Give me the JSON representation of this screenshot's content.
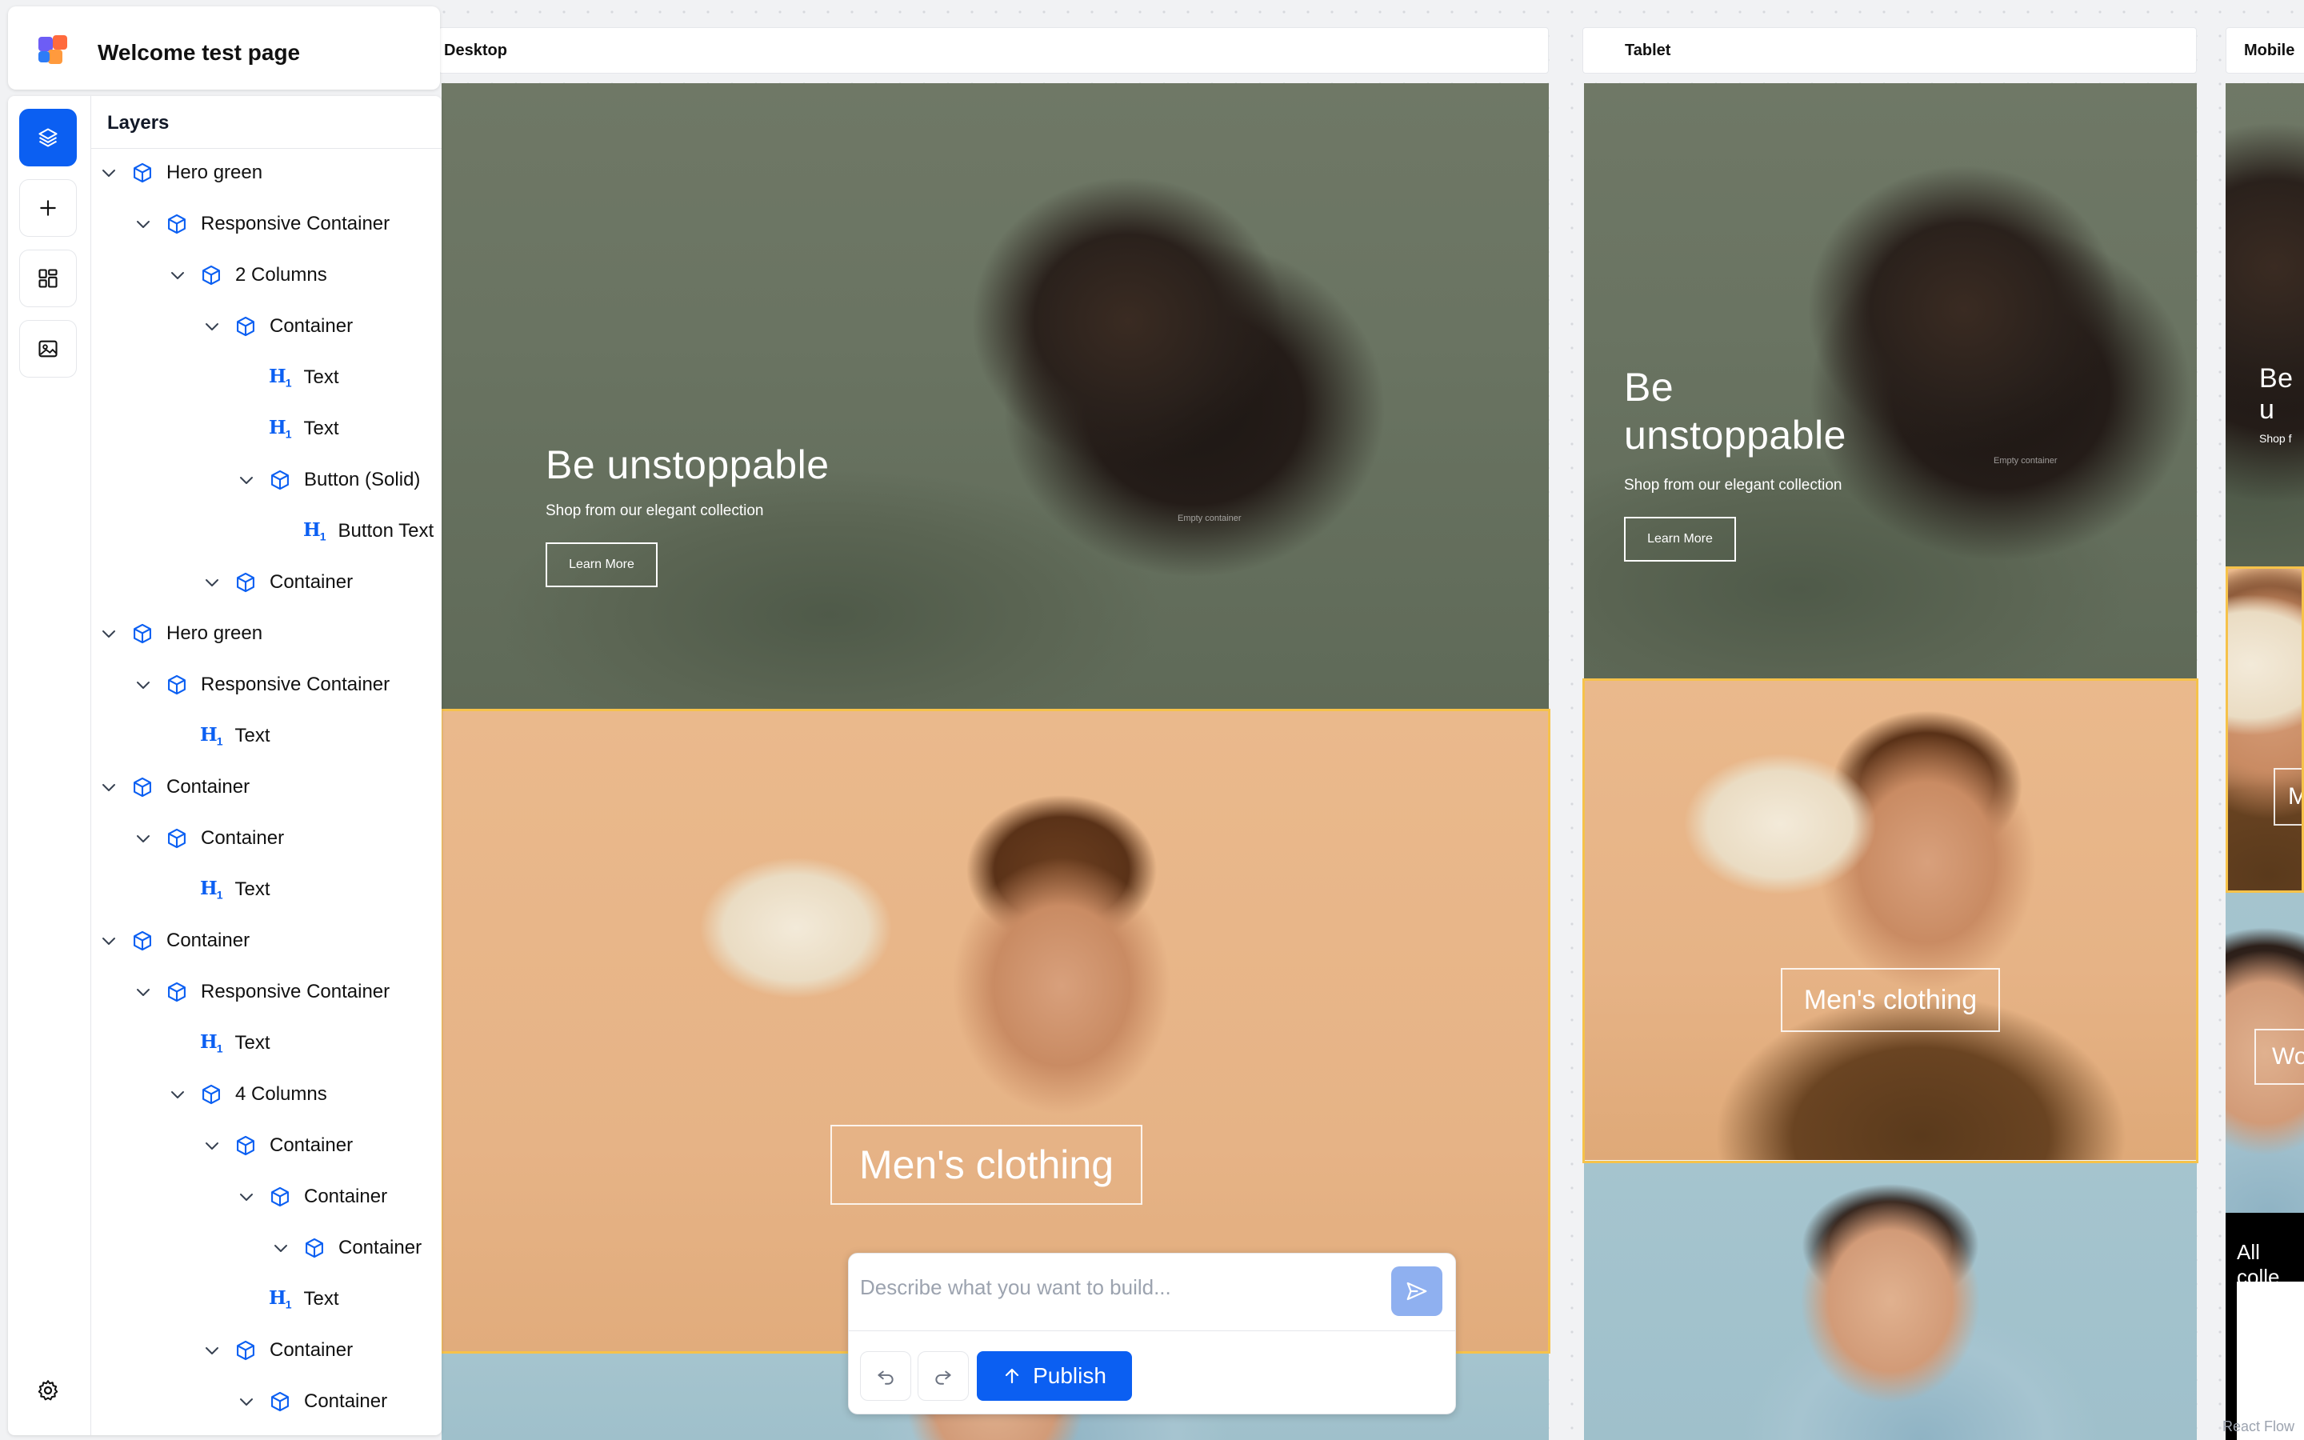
{
  "app": {
    "page_title": "Welcome test page"
  },
  "panel": {
    "layers_title": "Layers",
    "rail": [
      "layers-icon",
      "plus-icon",
      "blocks-icon",
      "image-icon",
      "gear-icon"
    ],
    "layers": [
      {
        "label": "Hero green",
        "type": "box",
        "depth": 0,
        "expanded": true
      },
      {
        "label": "Responsive Container",
        "type": "box",
        "depth": 1,
        "expanded": true
      },
      {
        "label": "2 Columns",
        "type": "box",
        "depth": 2,
        "expanded": true
      },
      {
        "label": "Container",
        "type": "box",
        "depth": 3,
        "expanded": true
      },
      {
        "label": "Text",
        "type": "heading",
        "depth": 4
      },
      {
        "label": "Text",
        "type": "heading",
        "depth": 4
      },
      {
        "label": "Button (Solid)",
        "type": "box",
        "depth": 4,
        "expanded": true
      },
      {
        "label": "Button Text",
        "type": "heading",
        "depth": 5
      },
      {
        "label": "Container",
        "type": "box",
        "depth": 3,
        "expanded": true
      },
      {
        "label": "Hero green",
        "type": "box",
        "depth": 0,
        "expanded": true
      },
      {
        "label": "Responsive Container",
        "type": "box",
        "depth": 1,
        "expanded": true
      },
      {
        "label": "Text",
        "type": "heading",
        "depth": 2
      },
      {
        "label": "Container",
        "type": "box",
        "depth": 0,
        "expanded": true
      },
      {
        "label": "Container",
        "type": "box",
        "depth": 1,
        "expanded": true
      },
      {
        "label": "Text",
        "type": "heading",
        "depth": 2
      },
      {
        "label": "Container",
        "type": "box",
        "depth": 0,
        "expanded": true
      },
      {
        "label": "Responsive Container",
        "type": "box",
        "depth": 1,
        "expanded": true
      },
      {
        "label": "Text",
        "type": "heading",
        "depth": 2
      },
      {
        "label": "4 Columns",
        "type": "box",
        "depth": 2,
        "expanded": true
      },
      {
        "label": "Container",
        "type": "box",
        "depth": 3,
        "expanded": true
      },
      {
        "label": "Container",
        "type": "box",
        "depth": 4,
        "expanded": true
      },
      {
        "label": "Container",
        "type": "box",
        "depth": 5,
        "expanded": true
      },
      {
        "label": "Text",
        "type": "heading",
        "depth": 4
      },
      {
        "label": "Container",
        "type": "box",
        "depth": 3,
        "expanded": true
      },
      {
        "label": "Container",
        "type": "box",
        "depth": 4,
        "expanded": true
      }
    ],
    "heading_glyph": "H",
    "heading_sub": "1"
  },
  "frames": {
    "desktop": {
      "label": "Desktop",
      "hero_title": "Be unstoppable",
      "hero_sub": "Shop from our elegant collection",
      "button": "Learn More",
      "empty": "Empty container",
      "category": "Men's clothing"
    },
    "tablet": {
      "label": "Tablet",
      "hero_title_1": "Be",
      "hero_title_2": "unstoppable",
      "hero_sub": "Shop from our elegant collection",
      "button": "Learn More",
      "empty": "Empty container",
      "category": "Men's clothing"
    },
    "mobile": {
      "label": "Mobile",
      "hero_title": "Be u",
      "hero_sub": "Shop f",
      "category_a": "M",
      "category_b": "Wo",
      "collections": "All colle"
    }
  },
  "chat": {
    "placeholder": "Describe what you want to build...",
    "publish": "Publish"
  },
  "watermark": "React Flow",
  "colors": {
    "accent": "#0b5ff2",
    "selection": "#f6c24a"
  }
}
